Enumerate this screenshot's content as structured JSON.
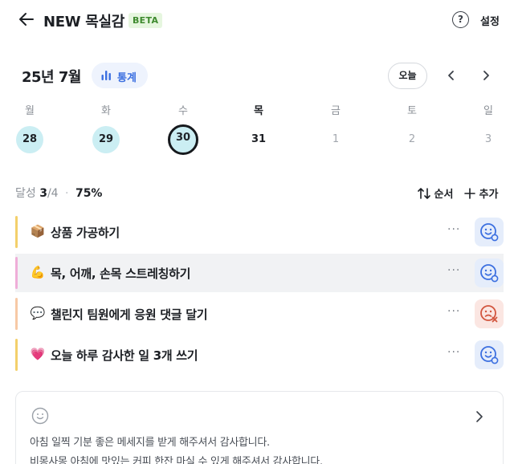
{
  "header": {
    "title": "NEW 목실감",
    "badge": "BETA",
    "help_glyph": "?",
    "settings_label": "설정"
  },
  "calendar": {
    "month_label": "25년 7월",
    "stats_label": "통계",
    "today_label": "오늘",
    "weekdays": [
      "월",
      "화",
      "수",
      "목",
      "금",
      "토",
      "일"
    ],
    "days": [
      "28",
      "29",
      "30",
      "31",
      "1",
      "2",
      "3"
    ]
  },
  "summary": {
    "label": "달성",
    "done": "3",
    "total": "/4",
    "separator": "·",
    "percent": "75%",
    "order_label": "순서",
    "add_label": "추가"
  },
  "tasks": [
    {
      "emoji": "📦",
      "label": "상품 가공하기",
      "more": "···",
      "status": "happy",
      "bar_color": "#f3d06b"
    },
    {
      "emoji": "💪",
      "label": "목, 어깨, 손목 스트레칭하기",
      "more": "···",
      "status": "happy",
      "bar_color": "#efaed8"
    },
    {
      "emoji": "💬",
      "label": "챌린지 팀원에게 응원 댓글 달기",
      "more": "···",
      "status": "sad",
      "bar_color": "#f7c9a6"
    },
    {
      "emoji": "💗",
      "label": "오늘 하루 감사한 일 3개 쓰기",
      "more": "···",
      "status": "happy",
      "bar_color": "#f3d06b"
    }
  ],
  "note": {
    "lines": [
      "아침 일찍 기분 좋은 메세지를 받게 해주셔서 감사합니다.",
      "비몽사몽 아침에 맛있는 커피 한잔 마실 수 있게 해주셔서 감사합니다."
    ]
  },
  "colors": {
    "accent": "#3b6fe0",
    "done_day": "#cbeef3",
    "happy_bg": "#e5edfb",
    "sad_bg": "#fbe6e2"
  }
}
